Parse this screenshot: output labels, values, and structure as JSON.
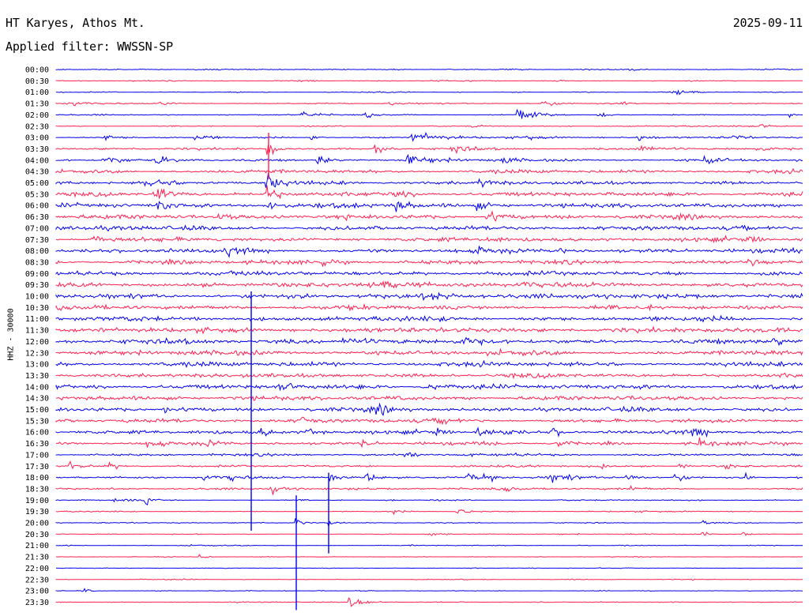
{
  "header": {
    "station": "HT Karyes, Athos Mt.",
    "date": "2025-09-11",
    "filter": "Applied filter: WWSSN-SP"
  },
  "axis": {
    "channel_label": "HHZ - 30000"
  },
  "colors": {
    "blue": "#0000ee",
    "red": "#ff1f4f"
  },
  "chart_data": {
    "type": "line",
    "subtype": "helicorder",
    "ylabel": "HHZ - 30000",
    "row_labels": [
      "00:00",
      "00:30",
      "01:00",
      "01:30",
      "02:00",
      "02:30",
      "03:00",
      "03:30",
      "04:00",
      "04:30",
      "05:00",
      "05:30",
      "06:00",
      "06:30",
      "07:00",
      "07:30",
      "08:00",
      "08:30",
      "09:00",
      "09:30",
      "10:00",
      "10:30",
      "11:00",
      "11:30",
      "12:00",
      "12:30",
      "13:00",
      "13:30",
      "14:00",
      "14:30",
      "15:00",
      "15:30",
      "16:00",
      "16:30",
      "17:00",
      "17:30",
      "18:00",
      "18:30",
      "19:00",
      "19:30",
      "20:00",
      "20:30",
      "21:00",
      "21:30",
      "22:00",
      "22:30",
      "23:00",
      "23:30"
    ],
    "row_colors": [
      "blue",
      "red"
    ],
    "relative_noise_amplitude": [
      0.8,
      0.9,
      0.9,
      1.0,
      1.0,
      1.1,
      1.8,
      2.2,
      2.8,
      3.8,
      4.2,
      4.6,
      4.8,
      4.8,
      4.6,
      4.5,
      4.6,
      4.4,
      4.8,
      5.0,
      5.2,
      5.2,
      5.3,
      5.4,
      5.4,
      5.2,
      5.2,
      5.0,
      5.0,
      4.8,
      4.6,
      4.2,
      3.9,
      3.4,
      2.4,
      2.4,
      2.4,
      2.2,
      1.4,
      1.0,
      0.8,
      0.8,
      0.6,
      0.5,
      0.5,
      0.4,
      0.4,
      0.4
    ]
  }
}
